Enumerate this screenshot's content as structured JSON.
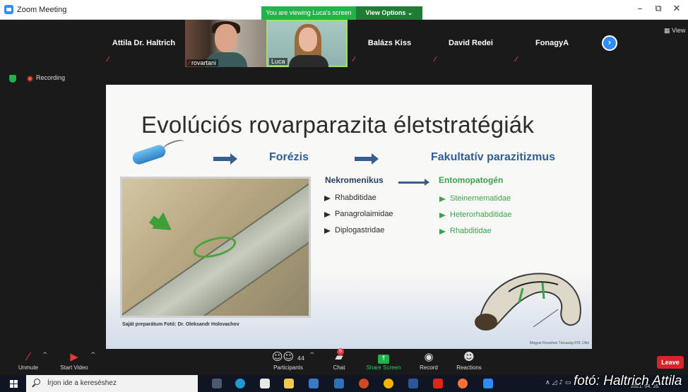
{
  "window": {
    "title": "Zoom Meeting",
    "minimize": "–",
    "restore": "⧉",
    "close": "✕"
  },
  "banner": {
    "viewing": "You are viewing Luca's screen",
    "view_options": "View Options ⌄"
  },
  "participants": [
    {
      "name": "Attila Dr. Haltrich",
      "muted": true
    },
    {
      "name": "rovartani",
      "muted": true,
      "video": true
    },
    {
      "name": "Luca",
      "muted": false,
      "video": true,
      "active_speaker": true
    },
    {
      "name": "Balázs Kiss",
      "muted": true
    },
    {
      "name": "David Redei",
      "muted": true
    },
    {
      "name": "FonagyA",
      "muted": true
    }
  ],
  "strip": {
    "next_icon": "›",
    "view_label": "▦ View"
  },
  "recording": {
    "label": "Recording"
  },
  "slide": {
    "title": "Evolúciós rovarparazita életstratégiák",
    "phoresis": "Forézis",
    "facultative": "Fakultatív parazitizmus",
    "necro_title": "Nekromenikus",
    "necro_items": [
      "Rhabditidae",
      "Panagrolaimidae",
      "Diplogastridae"
    ],
    "ento_title": "Entomopatogén",
    "ento_items": [
      "Steinernematidae",
      "Heterorhabditidae",
      "Rhabditidae"
    ],
    "caption": "Saját preparátum Fotó: Dr. Oleksandr Holovachov",
    "larva_citation": "Magyar Rovartani Társaság 878. Ülés"
  },
  "toolbar": {
    "unmute": "Unmute",
    "start_video": "Start Video",
    "participants": "Participants",
    "participant_count": "44",
    "chat": "Chat",
    "chat_badge": "5",
    "share": "Share Screen",
    "record": "Record",
    "reactions": "Reactions",
    "leave": "Leave",
    "caret": "^"
  },
  "taskbar": {
    "search_placeholder": "Írjon ide a kereséshez",
    "tray": "∧ ◿ ♪ ▭",
    "clock": "2021. 04. 16."
  },
  "watermark": "fotó: Haltrich Attila",
  "colors": {
    "accent": "#2d8cff",
    "share_green": "#23b14d",
    "leave_red": "#d8232a",
    "slide_blue": "#2f5f94",
    "slide_green": "#3aa34a"
  }
}
